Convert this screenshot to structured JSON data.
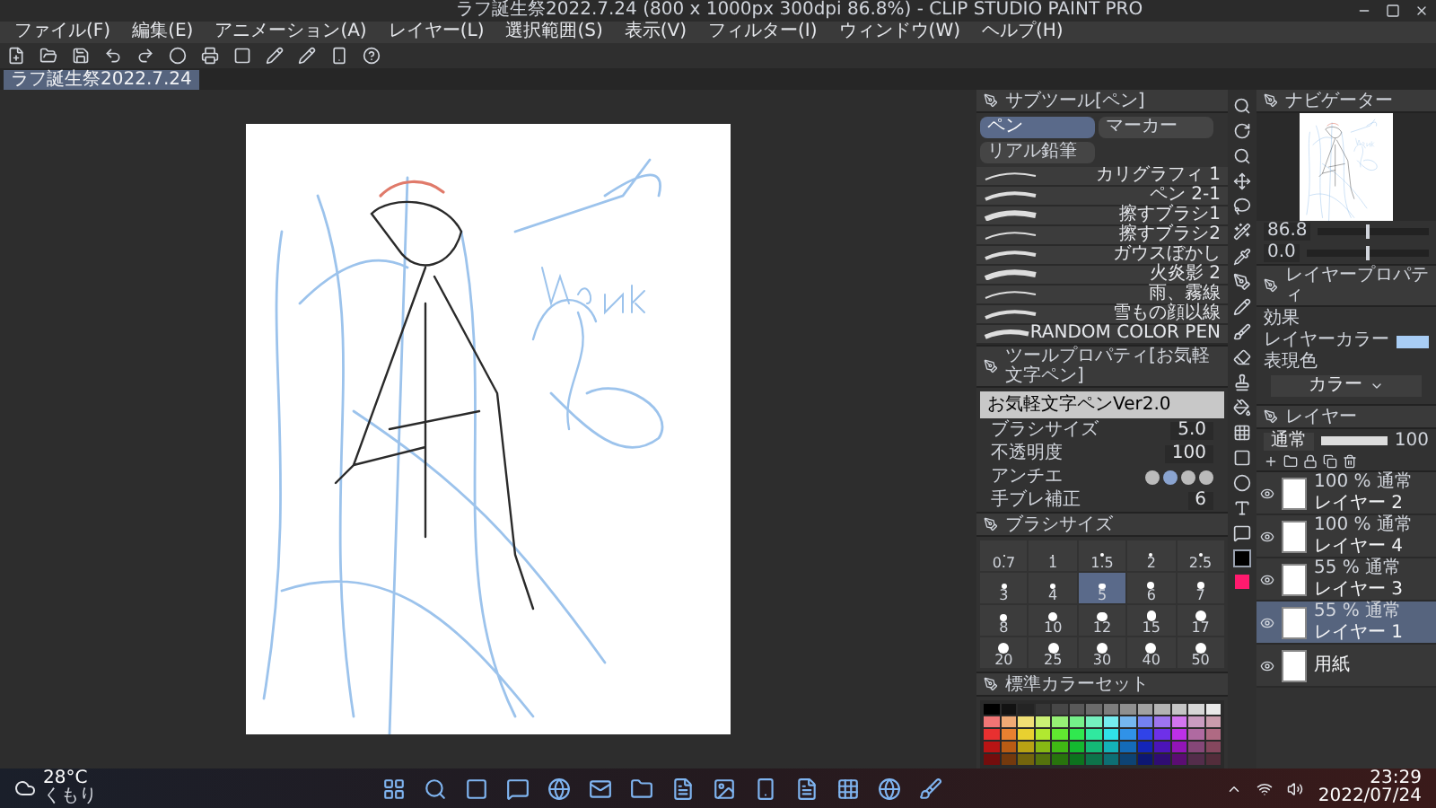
{
  "window": {
    "title": "ラフ誕生祭2022.7.24 (800 x 1000px 300dpi 86.8%) - CLIP STUDIO PAINT PRO"
  },
  "menu": [
    "ファイル(F)",
    "編集(E)",
    "アニメーション(A)",
    "レイヤー(L)",
    "選択範囲(S)",
    "表示(V)",
    "フィルター(I)",
    "ウィンドウ(W)",
    "ヘルプ(H)"
  ],
  "document_tab": {
    "label": "ラフ誕生祭2022.7.24"
  },
  "sub_tool": {
    "title": "サブツール[ペン]",
    "groups": [
      {
        "label": "ペン",
        "selected": true
      },
      {
        "label": "マーカー",
        "selected": false
      },
      {
        "label": "リアル鉛筆",
        "selected": false
      }
    ],
    "brushes": [
      "カリグラフィ 1",
      "ペン 2-1",
      "擦すブラシ1",
      "擦すブラシ2",
      "ガウスぼかし",
      "火炎影 2",
      "雨、霧線",
      "雪もの顔以線",
      "RANDOM COLOR PEN"
    ]
  },
  "tool_property": {
    "title": "ツールプロパティ[お気軽文字ペン]",
    "preview": "お気軽文字ペンVer2.0",
    "rows": [
      {
        "label": "ブラシサイズ",
        "value": "5.0"
      },
      {
        "label": "不透明度",
        "value": "100"
      },
      {
        "label": "アンチエ"
      },
      {
        "label": "手ブレ補正",
        "value": "6"
      }
    ]
  },
  "brush_size": {
    "title": "ブラシサイズ",
    "sizes": [
      {
        "label": "0.7",
        "selected": false
      },
      {
        "label": "1",
        "selected": false
      },
      {
        "label": "1.5",
        "selected": false
      },
      {
        "label": "2",
        "selected": false
      },
      {
        "label": "2.5",
        "selected": false
      },
      {
        "label": "3",
        "selected": false
      },
      {
        "label": "4",
        "selected": false
      },
      {
        "label": "5",
        "selected": true
      },
      {
        "label": "6",
        "selected": false
      },
      {
        "label": "7",
        "selected": false
      },
      {
        "label": "8",
        "selected": false
      },
      {
        "label": "10",
        "selected": false
      },
      {
        "label": "12",
        "selected": false
      },
      {
        "label": "15",
        "selected": false
      },
      {
        "label": "17",
        "selected": false
      },
      {
        "label": "20",
        "selected": false
      },
      {
        "label": "25",
        "selected": false
      },
      {
        "label": "30",
        "selected": false
      },
      {
        "label": "40",
        "selected": false
      },
      {
        "label": "50",
        "selected": false
      }
    ]
  },
  "color_set": {
    "title": "標準カラーセット"
  },
  "navigator": {
    "title": "ナビゲーター",
    "sliders": [
      {
        "value": "86.8",
        "level": 0.45
      },
      {
        "value": "0.0",
        "level": 0.5
      }
    ]
  },
  "layer_property": {
    "title": "レイヤープロパティ",
    "effect_label": "効果",
    "layer_color_label": "レイヤーカラー",
    "expression_label": "表現色",
    "expression_value": "カラー"
  },
  "layers": {
    "title": "レイヤー",
    "blend": "通常",
    "opacity": "100",
    "level": 1,
    "items": [
      {
        "mode": "100 % 通常",
        "name": "レイヤー 2",
        "visible": true,
        "selected": false
      },
      {
        "mode": "100 % 通常",
        "name": "レイヤー 4",
        "visible": true,
        "selected": false
      },
      {
        "mode": "55 % 通常",
        "name": "レイヤー 3",
        "visible": true,
        "selected": false
      },
      {
        "mode": "55 % 通常",
        "name": "レイヤー 1",
        "visible": true,
        "selected": true
      },
      {
        "name": "用紙",
        "visible": true,
        "selected": false
      }
    ]
  },
  "taskbar": {
    "temperature": "28°C",
    "weather": "くもり",
    "time": "23:29",
    "date": "2022/07/24"
  }
}
